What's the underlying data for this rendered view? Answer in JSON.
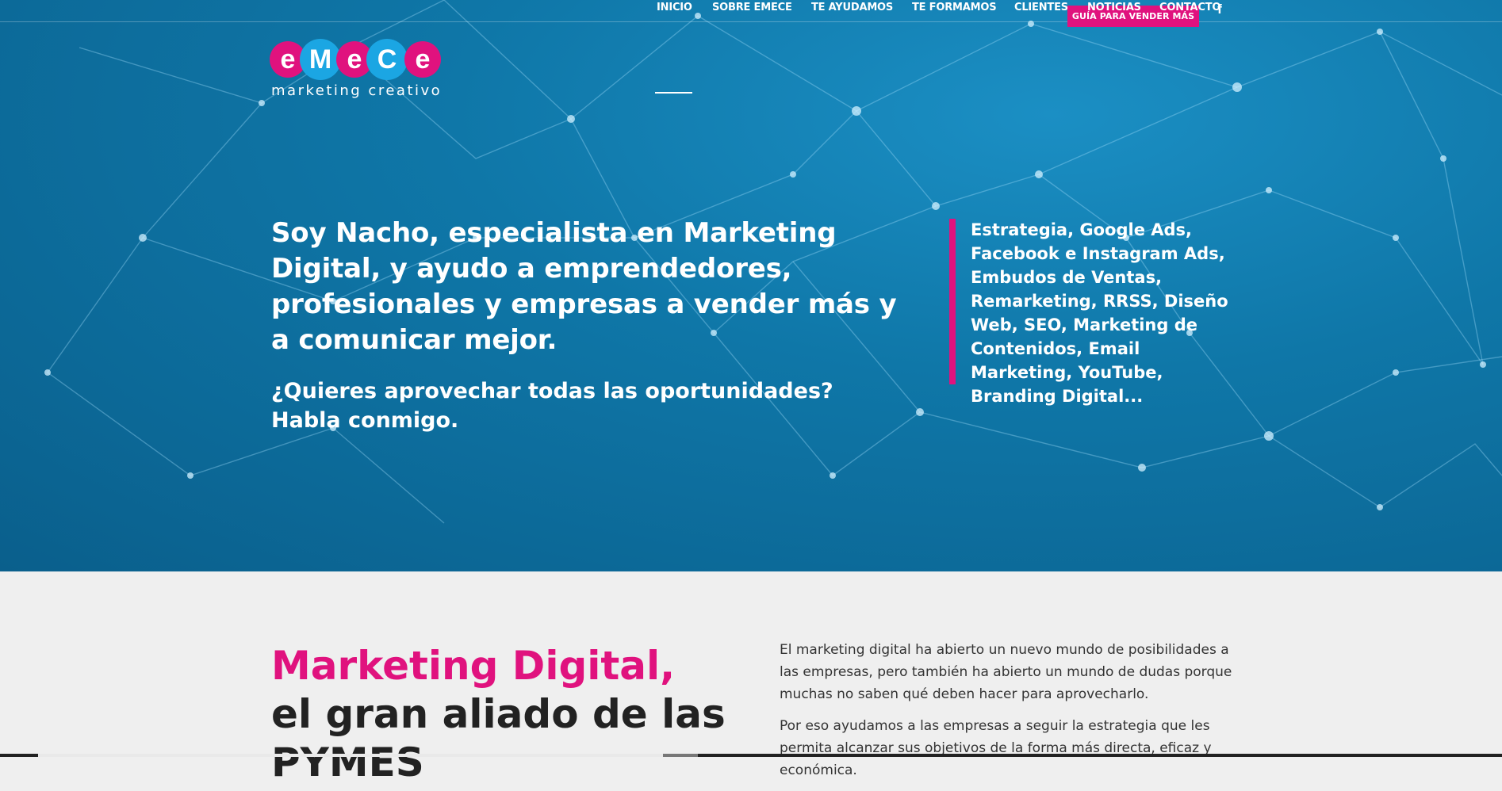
{
  "colors": {
    "brand_pink": "#e0127e",
    "hero_blue": "#0f77a8",
    "nav_text": "#ffffff"
  },
  "topbar": {
    "guide_button": "GUÍA PARA VENDER MÁS",
    "facebook_icon": "facebook-icon",
    "facebook_glyph": "f"
  },
  "logo": {
    "letters": [
      "e",
      "M",
      "e",
      "C",
      "e"
    ],
    "letter_colors": [
      "#e0127e",
      "#1ba6e3",
      "#e0127e",
      "#1ba6e3",
      "#e0127e"
    ],
    "tagline": "marketing creativo"
  },
  "nav": {
    "items": [
      {
        "label": "INICIO",
        "active": true
      },
      {
        "label": "SOBRE EMECE",
        "active": false
      },
      {
        "label": "TE AYUDAMOS",
        "active": false
      },
      {
        "label": "TE FORMAMOS",
        "active": false
      },
      {
        "label": "CLIENTES",
        "active": false
      },
      {
        "label": "NOTICIAS",
        "active": false
      },
      {
        "label": "CONTACTO",
        "active": false
      }
    ]
  },
  "hero": {
    "headline": "Soy Nacho, especialista en Marketing Digital, y ayudo a emprendedores, profesionales y empresas a vender más y a comunicar mejor.",
    "subheadline_line1": "¿Quieres aprovechar todas las oportunidades?",
    "subheadline_line2": "Habla conmigo.",
    "services": "Estrategia, Google Ads, Facebook e Instagram Ads, Embudos de Ventas, Remarketing, RRSS, Diseño Web, SEO, Marketing de Contenidos, Email Marketing, YouTube, Branding Digital..."
  },
  "intro": {
    "title_pink": "Marketing Digital,",
    "title_line2": "el gran aliado de las",
    "title_line3": "PYMES",
    "paragraph1": "El marketing digital ha abierto un nuevo mundo de posibilidades a las empresas, pero también ha abierto un mundo de dudas porque muchas no saben qué deben hacer para aprovecharlo.",
    "paragraph2": "Por eso ayudamos a las empresas a seguir la estrategia que les permita alcanzar sus objetivos de la forma más directa, eficaz y económica."
  }
}
